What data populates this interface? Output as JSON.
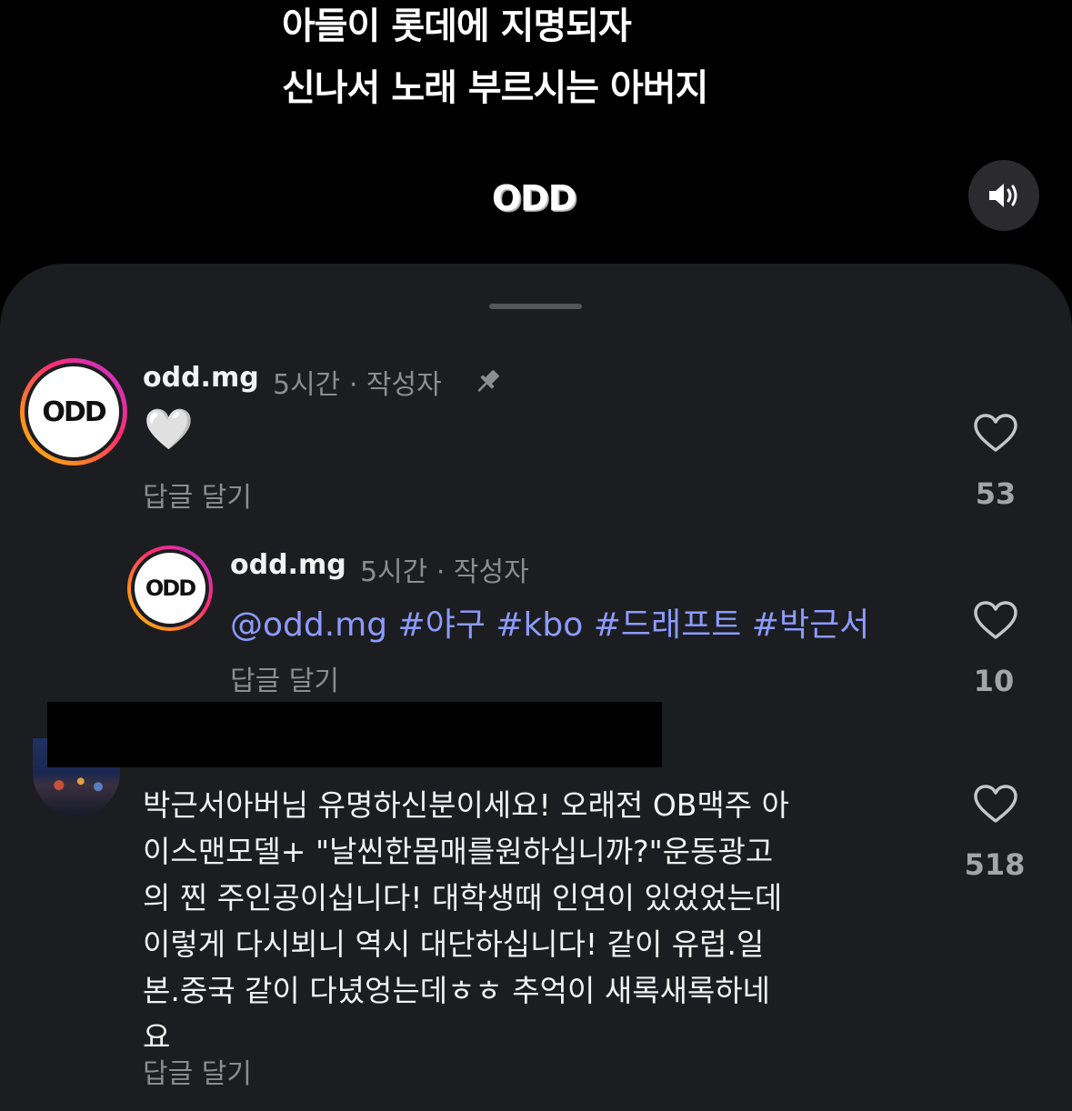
{
  "video": {
    "caption_line1": "아들이 롯데에 지명되자",
    "caption_line2": "신나서 노래 부르시는 아버지",
    "logo": "ODD",
    "volume_icon": "speaker-icon"
  },
  "comments": [
    {
      "username": "odd.mg",
      "meta": "5시간 · 작성자",
      "pinned": true,
      "text": "🤍",
      "reply_label": "답글 달기",
      "like_count": "53",
      "avatar_text": "ODD"
    },
    {
      "username": "odd.mg",
      "meta": "5시간 · 작성자",
      "text": "@odd.mg #야구 #kbo #드래프트 #박근서",
      "reply_label": "답글 달기",
      "like_count": "10",
      "avatar_text": "ODD"
    },
    {
      "username": "",
      "lines": [
        "박근서아버님 유명하신분이세요! 오래전 OB맥주 아",
        "이스맨모델+ \"날씬한몸매를원하십니까?\"운동광고",
        "의 찐 주인공이십니다! 대학생때 인연이 있었었는데",
        "이렇게 다시뵈니 역시 대단하십니다! 같이 유럽.일",
        "본.중국 같이 다녔엉는데ㅎㅎ 추억이 새록새록하네",
        "요"
      ],
      "reply_label": "답글 달기",
      "like_count": "518"
    }
  ]
}
